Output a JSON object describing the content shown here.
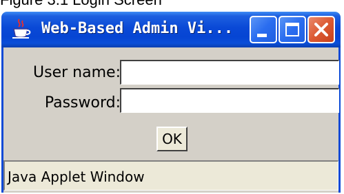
{
  "caption": "Figure 3.1 Login Screen",
  "window": {
    "title": "Web-Based Admin Vi...",
    "icon": "java-coffee-cup-icon",
    "controls": {
      "minimize_icon": "minimize-icon",
      "maximize_icon": "maximize-icon",
      "close_icon": "close-icon"
    }
  },
  "form": {
    "username_label": "User name:",
    "username_value": "",
    "password_label": "Password:",
    "password_value": "",
    "ok_label": "OK"
  },
  "status_bar": {
    "text": "Java Applet Window"
  },
  "colors": {
    "titlebar": "#0a49d6",
    "close_button": "#dc5a33",
    "panel": "#d4d0c8"
  }
}
